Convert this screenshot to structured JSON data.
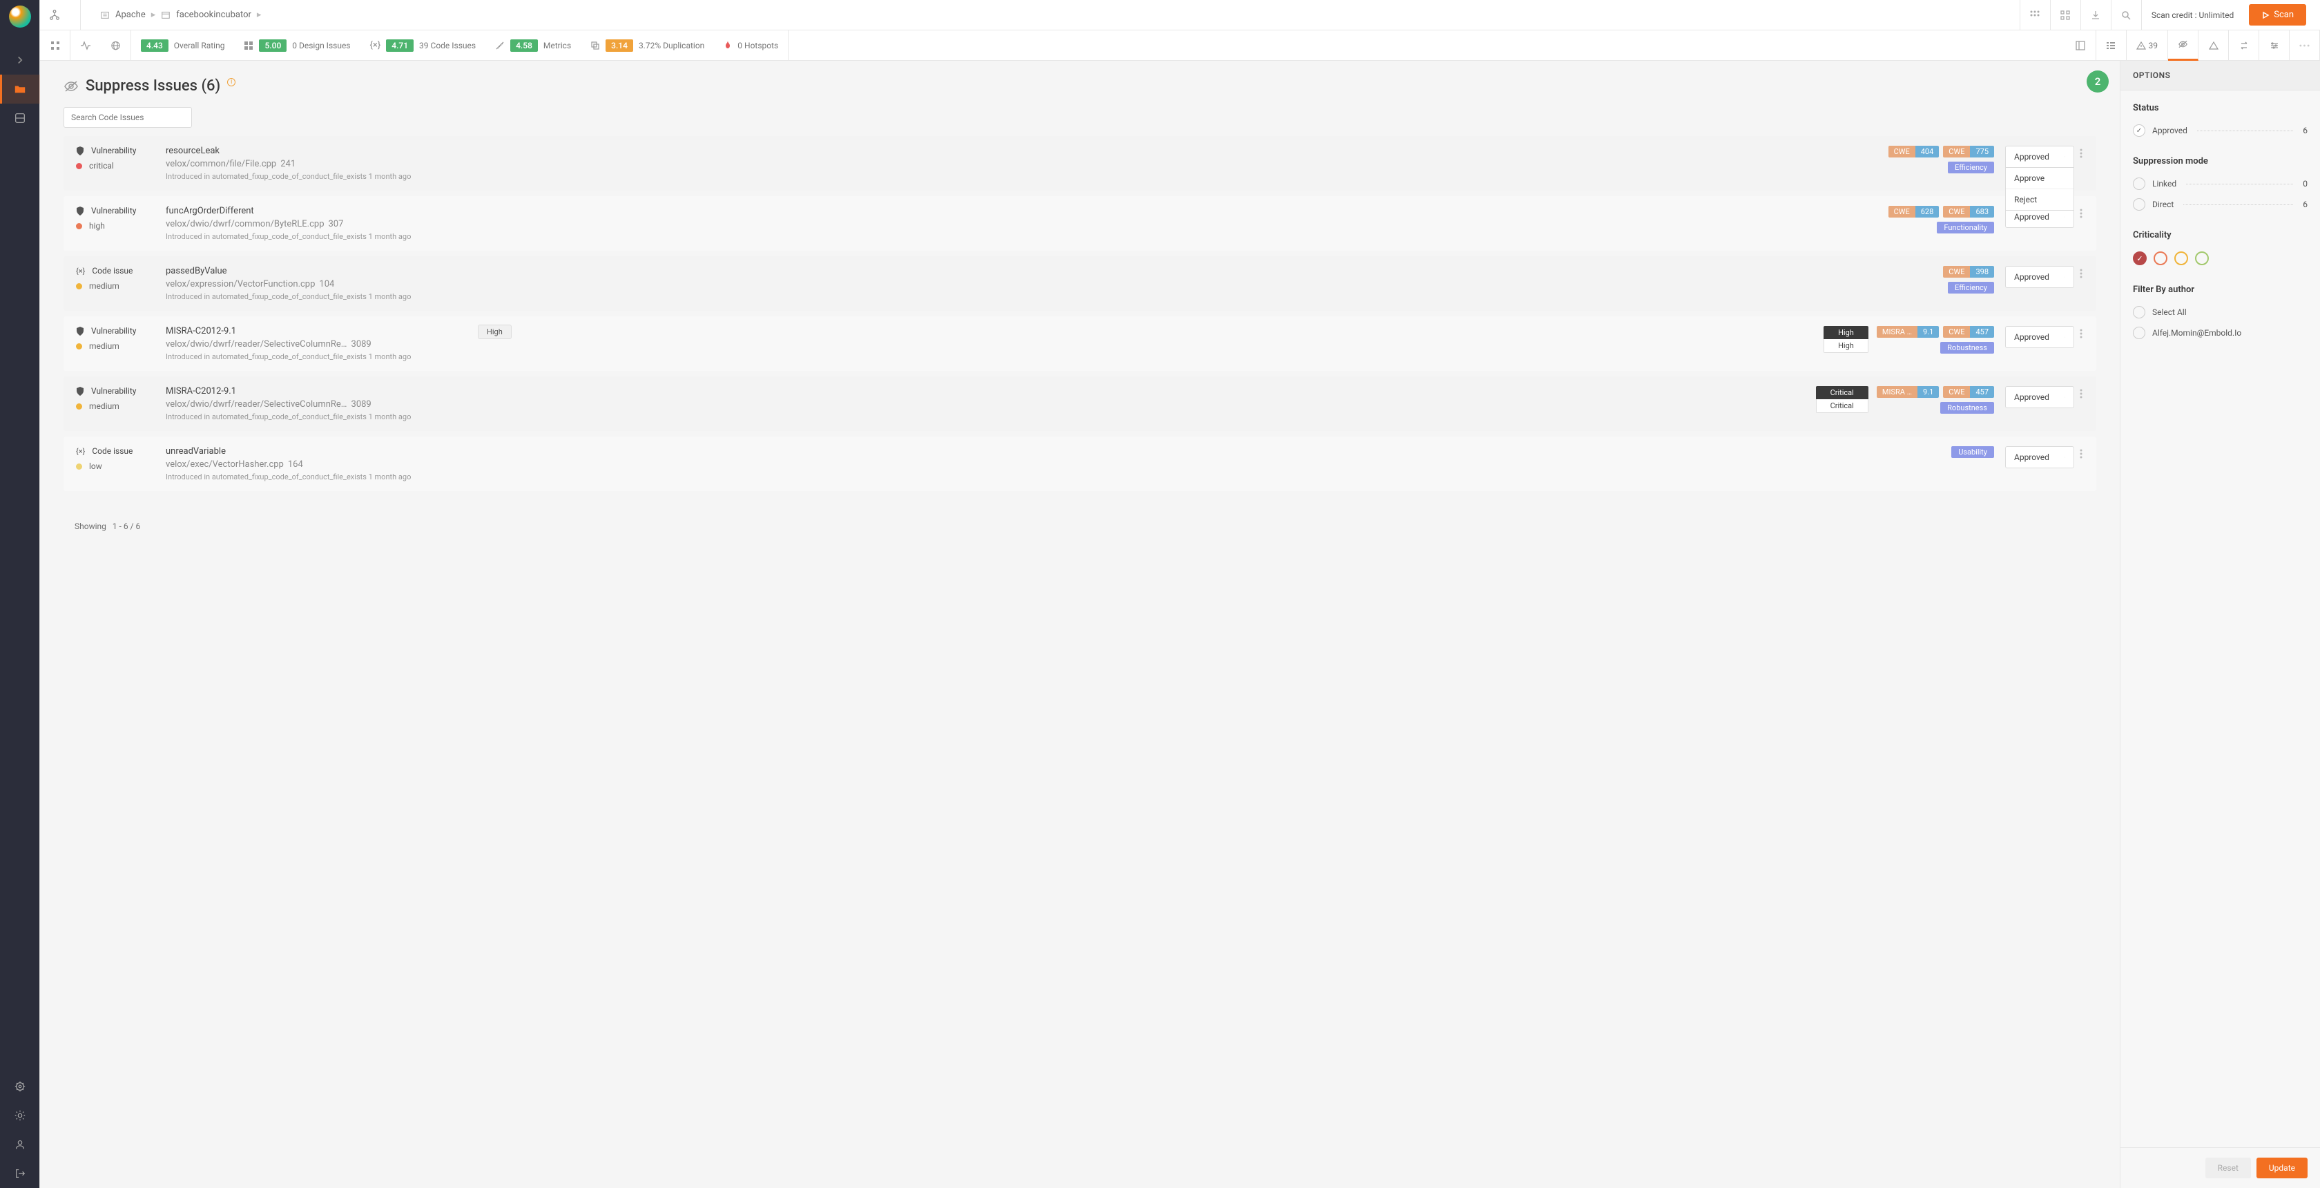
{
  "breadcrumb": {
    "org": "Apache",
    "repo": "facebookincubator"
  },
  "header": {
    "credit_label": "Scan credit : Unlimited",
    "scan_btn": "Scan"
  },
  "metrics": {
    "overall_rating": {
      "value": "4.43",
      "label": "Overall Rating"
    },
    "design": {
      "value": "5.00",
      "label": "0 Design Issues"
    },
    "code": {
      "value": "4.71",
      "label": "39 Code Issues"
    },
    "metrics": {
      "value": "4.58",
      "label": "Metrics"
    },
    "duplication": {
      "value": "3.14",
      "label": "3.72% Duplication"
    },
    "hotspots": {
      "label": "0 Hotspots"
    },
    "warn_count": "39"
  },
  "page": {
    "title": "Suppress Issues (6)",
    "search_placeholder": "Search Code Issues",
    "step_badge": "2",
    "showing": "Showing",
    "showing_range": "1 - 6 / 6"
  },
  "issues": [
    {
      "type": "Vulnerability",
      "severity": "critical",
      "sev_class": "crit",
      "name": "resourceLeak",
      "path": "velox/common/file/File.cpp",
      "line": "241",
      "intro": "Introduced in automated_fixup_code_of_conduct_file_exists 1 month ago",
      "cwes": [
        {
          "l": "CWE",
          "r": "404"
        },
        {
          "l": "CWE",
          "r": "775"
        }
      ],
      "category": "Efficiency",
      "status": "Approved",
      "dropdown_open": true,
      "dropdown_options": [
        "Approve",
        "Reject"
      ]
    },
    {
      "type": "Vulnerability",
      "severity": "high",
      "sev_class": "high",
      "name": "funcArgOrderDifferent",
      "path": "velox/dwio/dwrf/common/ByteRLE.cpp",
      "line": "307",
      "intro": "Introduced in automated_fixup_code_of_conduct_file_exists 1 month ago",
      "cwes": [
        {
          "l": "CWE",
          "r": "628"
        },
        {
          "l": "CWE",
          "r": "683"
        }
      ],
      "category": "Functionality",
      "status": "Approved"
    },
    {
      "type": "Code issue",
      "severity": "medium",
      "sev_class": "med",
      "name": "passedByValue",
      "path": "velox/expression/VectorFunction.cpp",
      "line": "104",
      "intro": "Introduced in automated_fixup_code_of_conduct_file_exists 1 month ago",
      "cwes": [
        {
          "l": "CWE",
          "r": "398"
        }
      ],
      "category": "Efficiency",
      "status": "Approved"
    },
    {
      "type": "Vulnerability",
      "severity": "medium",
      "sev_class": "med",
      "name": "MISRA-C2012-9.1",
      "path": "velox/dwio/dwrf/reader/SelectiveColumnRe…",
      "line": "3089",
      "intro": "Introduced in automated_fixup_code_of_conduct_file_exists 1 month ago",
      "sev_chip": {
        "t": "High",
        "b": "High"
      },
      "float_chip": "High",
      "cwes": [
        {
          "l": "MISRA …",
          "r": "9.1"
        },
        {
          "l": "CWE",
          "r": "457"
        }
      ],
      "category": "Robustness",
      "status": "Approved"
    },
    {
      "type": "Vulnerability",
      "severity": "medium",
      "sev_class": "med",
      "name": "MISRA-C2012-9.1",
      "path": "velox/dwio/dwrf/reader/SelectiveColumnRe…",
      "line": "3089",
      "intro": "Introduced in automated_fixup_code_of_conduct_file_exists 1 month ago",
      "sev_chip": {
        "t": "Critical",
        "b": "Critical"
      },
      "cwes": [
        {
          "l": "MISRA …",
          "r": "9.1"
        },
        {
          "l": "CWE",
          "r": "457"
        }
      ],
      "category": "Robustness",
      "status": "Approved"
    },
    {
      "type": "Code issue",
      "severity": "low",
      "sev_class": "low",
      "name": "unreadVariable",
      "path": "velox/exec/VectorHasher.cpp",
      "line": "164",
      "intro": "Introduced in automated_fixup_code_of_conduct_file_exists 1 month ago",
      "cwes": [],
      "category": "Usability",
      "status": "Approved"
    }
  ],
  "options": {
    "title": "OPTIONS",
    "status_title": "Status",
    "status_items": [
      {
        "label": "Approved",
        "count": "6"
      }
    ],
    "suppression_title": "Suppression mode",
    "suppression_items": [
      {
        "label": "Linked",
        "count": "0"
      },
      {
        "label": "Direct",
        "count": "6"
      }
    ],
    "criticality_title": "Criticality",
    "filter_author_title": "Filter By author",
    "author_items": [
      {
        "label": "Select All"
      },
      {
        "label": "Alfej.Momin@Embold.Io"
      }
    ],
    "reset_btn": "Reset",
    "update_btn": "Update"
  }
}
